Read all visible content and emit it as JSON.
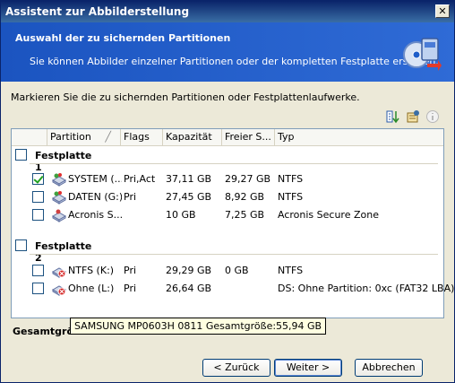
{
  "window": {
    "title": "Assistent zur Abbilderstellung",
    "close_glyph": "✕"
  },
  "banner": {
    "title": "Auswahl der zu sichernden Partitionen",
    "subtitle": "Sie können Abbilder einzelner Partitionen oder der kompletten Festplatte erstellen.",
    "icon": "disk-wizard-icon"
  },
  "instruction": "Markieren Sie die zu sichernden Partitionen oder Festplattenlaufwerke.",
  "toolbar_icons": [
    "sort-icon",
    "properties-icon",
    "info-icon"
  ],
  "columns": {
    "partition": "Partition",
    "flags": "Flags",
    "capacity": "Kapazität",
    "free": "Freier S...",
    "type": "Typ"
  },
  "groups": [
    {
      "label": "Festplatte 1",
      "checked": false,
      "rows": [
        {
          "name": "SYSTEM (...",
          "flags": "Pri,Act",
          "capacity": "37,11 GB",
          "free": "29,27 GB",
          "type": "NTFS",
          "checked": true
        },
        {
          "name": "DATEN (G:)",
          "flags": "Pri",
          "capacity": "27,45 GB",
          "free": "8,92 GB",
          "type": "NTFS",
          "checked": false
        },
        {
          "name": "Acronis S...",
          "flags": "",
          "capacity": "10 GB",
          "free": "7,25 GB",
          "type": "Acronis Secure Zone",
          "checked": false
        }
      ]
    },
    {
      "label": "Festplatte 2",
      "checked": false,
      "rows": [
        {
          "name": "NTFS (K:)",
          "flags": "Pri",
          "capacity": "29,29 GB",
          "free": "0 GB",
          "type": "NTFS",
          "checked": false
        },
        {
          "name": "Ohne (L:)",
          "flags": "Pri",
          "capacity": "26,64 GB",
          "free": "",
          "type": "DS: Ohne Partition: 0xc (FAT32 LBA)",
          "checked": false
        }
      ]
    }
  ],
  "tooltip": "SAMSUNG MP0603H 0811 Gesamtgröße:55,94 GB",
  "total_label": "Gesamtgrö",
  "buttons": {
    "back": "< Zurück",
    "next": "Weiter >",
    "cancel": "Abbrechen"
  }
}
